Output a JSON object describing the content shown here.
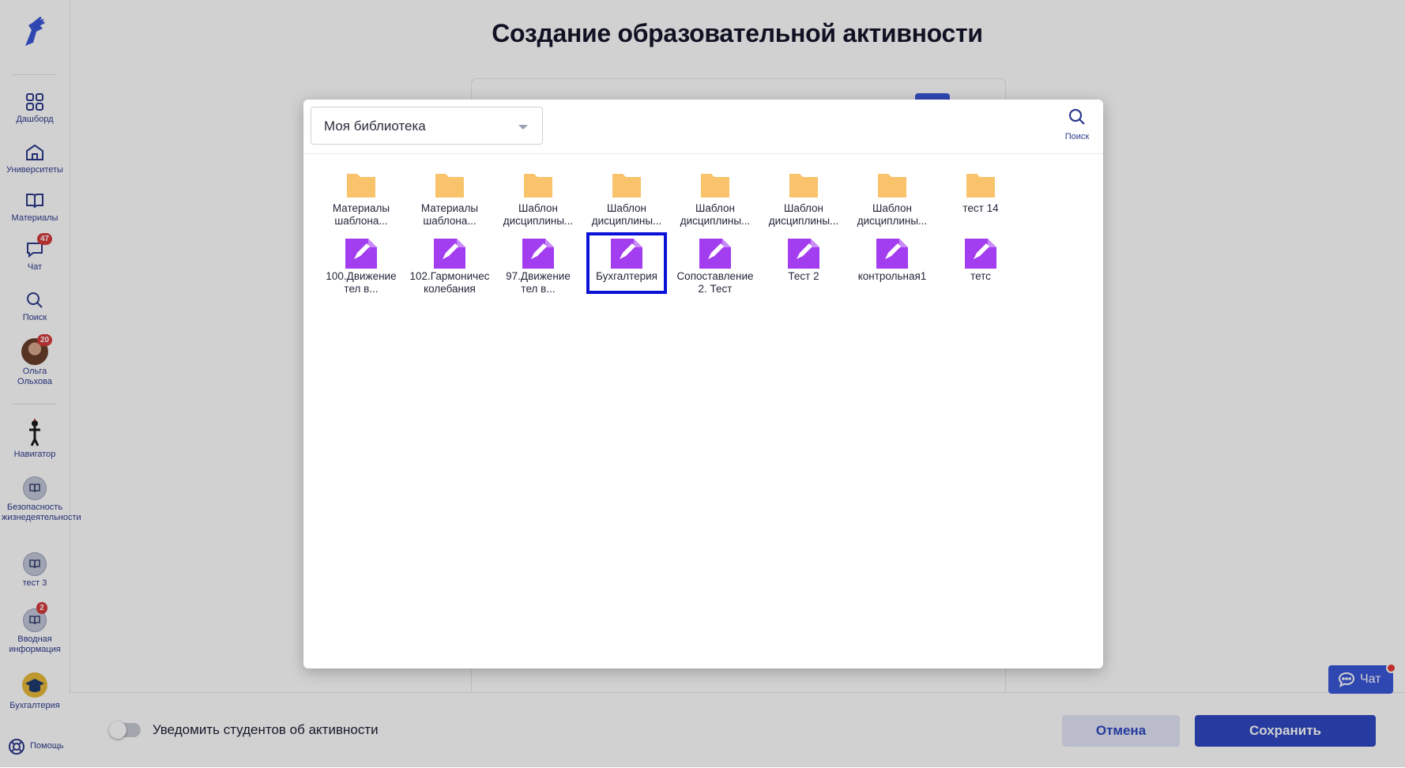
{
  "page": {
    "title": "Создание образовательной активности",
    "notify_label": "Уведомить студентов об активности",
    "cancel_label": "Отмена",
    "save_label": "Сохранить",
    "chat_float_label": "Чат"
  },
  "sidebar": {
    "items": [
      {
        "label": "Дашборд",
        "icon": "dashboard-icon"
      },
      {
        "label": "Университеты",
        "icon": "home-icon"
      },
      {
        "label": "Материалы",
        "icon": "book-icon"
      },
      {
        "label": "Чат",
        "icon": "chat-icon",
        "badge": "47"
      },
      {
        "label": "Поиск",
        "icon": "search-icon"
      },
      {
        "label": "Ольга Ольхова",
        "icon": "avatar",
        "badge": "20"
      },
      {
        "label": "Навигатор",
        "icon": "navigator-icon"
      },
      {
        "label": "Безопасность жизнедеятельности",
        "icon": "course-icon"
      },
      {
        "label": "тест 3",
        "icon": "course-icon"
      },
      {
        "label": "Вводная информация",
        "icon": "course-icon",
        "badge": "2"
      },
      {
        "label": "Бухгалтерия",
        "icon": "graduation-cap-icon"
      },
      {
        "label": "Помощь",
        "icon": "lifebuoy-icon"
      }
    ]
  },
  "modal": {
    "library_select": "Моя библиотека",
    "search_label": "Поиск",
    "folders": [
      {
        "name": "Материалы шаблона..."
      },
      {
        "name": "Материалы шаблона..."
      },
      {
        "name": "Шаблон дисциплины..."
      },
      {
        "name": "Шаблон дисциплины..."
      },
      {
        "name": "Шаблон дисциплины..."
      },
      {
        "name": "Шаблон дисциплины..."
      },
      {
        "name": "Шаблон дисциплины..."
      },
      {
        "name": "тест 14"
      }
    ],
    "documents": [
      {
        "name": "100.Движение тел в..."
      },
      {
        "name": "102.Гармоничес колебания"
      },
      {
        "name": "97.Движение тел в..."
      },
      {
        "name": "Бухгалтерия",
        "selected": true
      },
      {
        "name": "Сопоставление 2. Тест"
      },
      {
        "name": "Тест 2"
      },
      {
        "name": "контрольная1"
      },
      {
        "name": "тетс"
      }
    ]
  },
  "colors": {
    "accent": "#2f47c2",
    "folder": "#f8c36a",
    "document": "#a33df0",
    "selection": "#0a12d8",
    "badge": "#d63b3b"
  }
}
